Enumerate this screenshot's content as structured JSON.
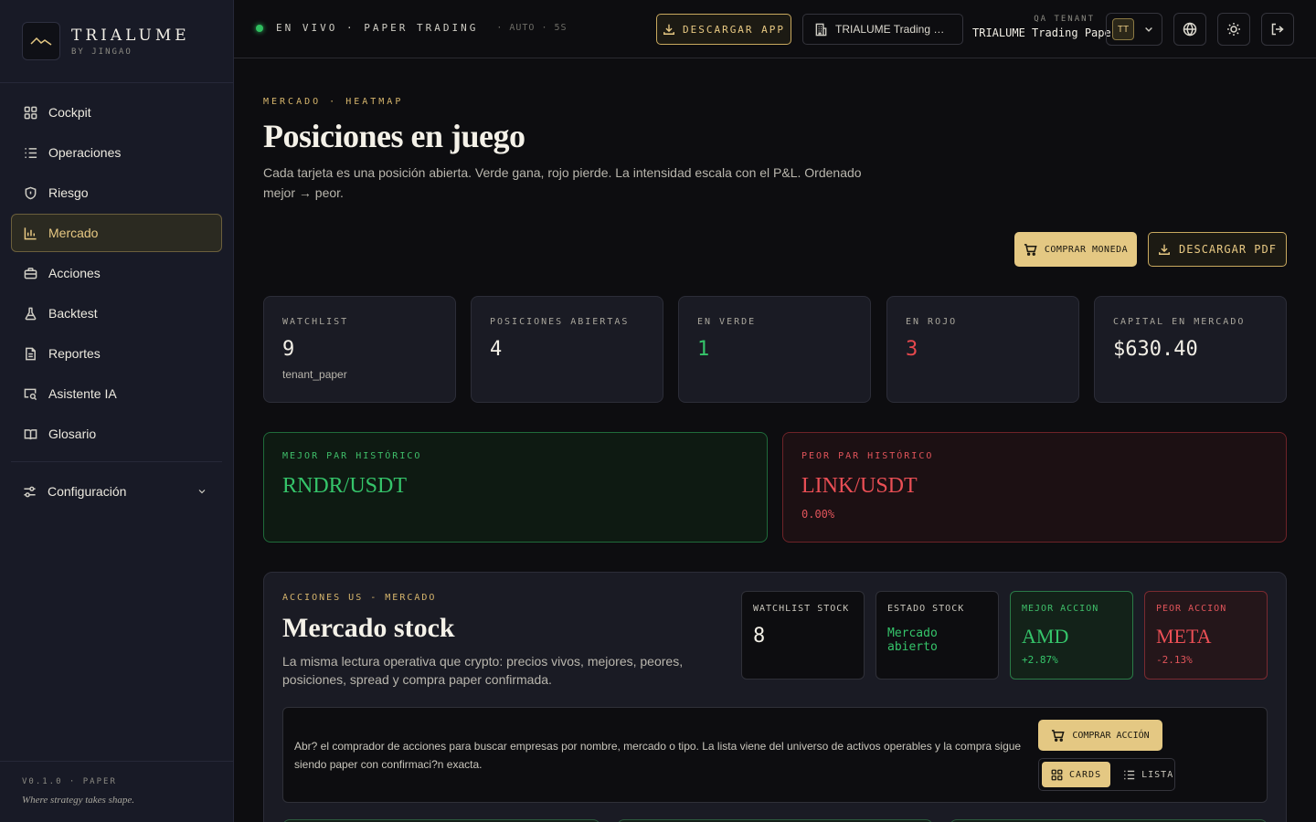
{
  "brand": {
    "name": "TRIALUME",
    "sub": "BY JINGAO"
  },
  "sidebar": {
    "items": [
      {
        "label": "Cockpit",
        "icon": "grid-icon"
      },
      {
        "label": "Operaciones",
        "icon": "list-icon"
      },
      {
        "label": "Riesgo",
        "icon": "shield-icon"
      },
      {
        "label": "Mercado",
        "icon": "bar-chart-icon",
        "active": true
      },
      {
        "label": "Acciones",
        "icon": "briefcase-icon"
      },
      {
        "label": "Backtest",
        "icon": "flask-icon"
      },
      {
        "label": "Reportes",
        "icon": "document-icon"
      },
      {
        "label": "Asistente IA",
        "icon": "chat-search-icon"
      },
      {
        "label": "Glosario",
        "icon": "book-icon"
      }
    ],
    "config_label": "Configuración",
    "version": "V0.1.0 · PAPER",
    "tagline": "Where strategy takes shape."
  },
  "topbar": {
    "live_text": "EN VIVO · PAPER TRADING",
    "auto_text": "· AUTO · 5S",
    "download_app": "DESCARGAR APP",
    "tenant_select": "TRIALUME Trading Pa...",
    "tenant_label": "QA TENANT",
    "tenant_name": "TRIALUME Trading Paper",
    "avatar_initials": "TT"
  },
  "page": {
    "eyebrow": "MERCADO · HEATMAP",
    "title": "Posiciones en juego",
    "description": "Cada tarjeta es una posición abierta. Verde gana, rojo pierde. La intensidad escala con el P&L. Ordenado mejor → peor.",
    "buy_coin": "COMPRAR MONEDA",
    "download_pdf": "DESCARGAR PDF"
  },
  "kpis": [
    {
      "label": "WATCHLIST",
      "value": "9",
      "sub": "tenant_paper",
      "tone": "neutral"
    },
    {
      "label": "POSICIONES ABIERTAS",
      "value": "4",
      "sub": "",
      "tone": "neutral"
    },
    {
      "label": "EN VERDE",
      "value": "1",
      "sub": "",
      "tone": "green"
    },
    {
      "label": "EN ROJO",
      "value": "3",
      "sub": "",
      "tone": "red"
    },
    {
      "label": "CAPITAL EN MERCADO",
      "value": "$630.40",
      "sub": "",
      "tone": "neutral"
    }
  ],
  "best_pair": {
    "label": "MEJOR PAR HISTÓRICO",
    "name": "RNDR/USDT"
  },
  "worst_pair": {
    "label": "PEOR PAR HISTÓRICO",
    "name": "LINK/USDT",
    "pct": "0.00%"
  },
  "stock": {
    "eyebrow": "ACCIONES US - MERCADO",
    "title": "Mercado stock",
    "description": "La misma lectura operativa que crypto: precios vivos, mejores, peores, posiciones, spread y compra paper confirmada.",
    "watchlist": {
      "label": "WATCHLIST STOCK",
      "value": "8"
    },
    "status": {
      "label": "ESTADO STOCK",
      "value": "Mercado abierto"
    },
    "best": {
      "label": "MEJOR ACCION",
      "value": "AMD",
      "pct": "+2.87%"
    },
    "worst": {
      "label": "PEOR ACCION",
      "value": "META",
      "pct": "-2.13%"
    },
    "buyer_text": "Abr? el comprador de acciones para buscar empresas por nombre, mercado o tipo. La lista viene del universo de activos operables y la compra sigue siendo paper con confirmaci?n exacta.",
    "buy_stock": "COMPRAR ACCIÓN",
    "view_cards": "CARDS",
    "view_list": "LISTA"
  },
  "colors": {
    "accent": "#e4c883",
    "green": "#35c46a",
    "red": "#e5484d",
    "bg": "#0d0d10",
    "panel": "#1a1b24"
  }
}
